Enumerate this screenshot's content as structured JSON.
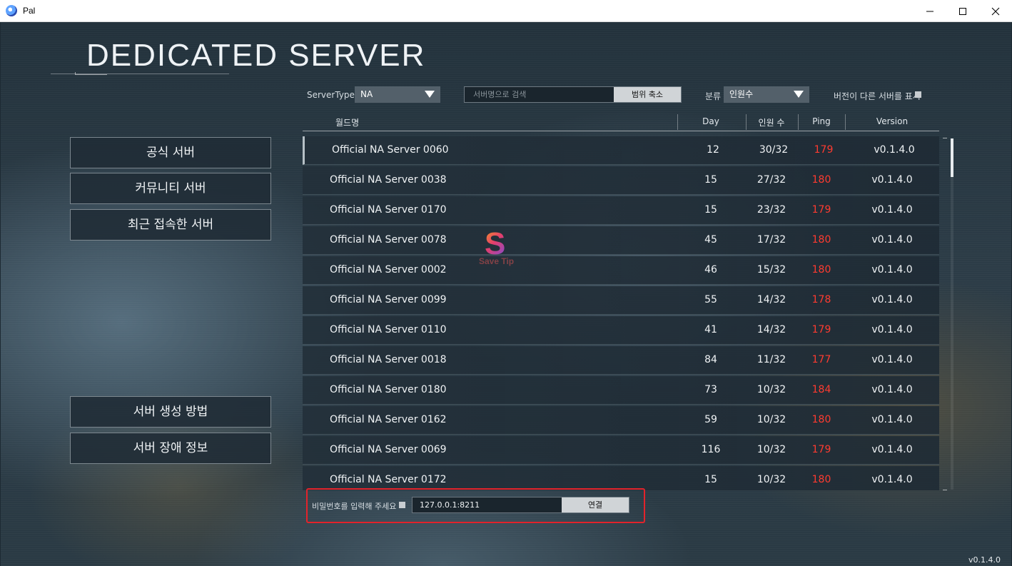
{
  "window": {
    "title": "Pal",
    "icon": "pal-app-icon",
    "controls": [
      "minimize-icon",
      "maximize-icon",
      "close-icon"
    ]
  },
  "header": {
    "title": "DEDICATED SERVER"
  },
  "filters": {
    "server_type_label": "ServerType",
    "server_type_value": "NA",
    "search_placeholder": "서버명으로 검색",
    "search_button": "범위 축소",
    "sort_label": "분류",
    "sort_value": "인원수",
    "show_other_versions_label": "버전이 다른 서버를 표시",
    "show_other_versions_checked": false
  },
  "table": {
    "columns": [
      "월드명",
      "Day",
      "인원 수",
      "Ping",
      "Version"
    ],
    "rows": [
      {
        "name": "Official NA Server 0060",
        "day": "12",
        "players": "30/32",
        "ping": "179",
        "version": "v0.1.4.0"
      },
      {
        "name": "Official NA Server 0038",
        "day": "15",
        "players": "27/32",
        "ping": "180",
        "version": "v0.1.4.0"
      },
      {
        "name": "Official NA Server 0170",
        "day": "15",
        "players": "23/32",
        "ping": "179",
        "version": "v0.1.4.0"
      },
      {
        "name": "Official NA Server 0078",
        "day": "45",
        "players": "17/32",
        "ping": "180",
        "version": "v0.1.4.0"
      },
      {
        "name": "Official NA Server 0002",
        "day": "46",
        "players": "15/32",
        "ping": "180",
        "version": "v0.1.4.0"
      },
      {
        "name": "Official NA Server 0099",
        "day": "55",
        "players": "14/32",
        "ping": "178",
        "version": "v0.1.4.0"
      },
      {
        "name": "Official NA Server 0110",
        "day": "41",
        "players": "14/32",
        "ping": "179",
        "version": "v0.1.4.0"
      },
      {
        "name": "Official NA Server 0018",
        "day": "84",
        "players": "11/32",
        "ping": "177",
        "version": "v0.1.4.0"
      },
      {
        "name": "Official NA Server 0180",
        "day": "73",
        "players": "10/32",
        "ping": "184",
        "version": "v0.1.4.0"
      },
      {
        "name": "Official NA Server 0162",
        "day": "59",
        "players": "10/32",
        "ping": "180",
        "version": "v0.1.4.0"
      },
      {
        "name": "Official NA Server 0069",
        "day": "116",
        "players": "10/32",
        "ping": "179",
        "version": "v0.1.4.0"
      },
      {
        "name": "Official NA Server 0172",
        "day": "15",
        "players": "10/32",
        "ping": "180",
        "version": "v0.1.4.0"
      }
    ],
    "ping_color": "#ff3b30"
  },
  "sidebar": {
    "top_items": [
      {
        "label": "공식 서버"
      },
      {
        "label": "커뮤니티 서버"
      },
      {
        "label": "최근 접속한 서버"
      }
    ],
    "bottom_items": [
      {
        "label": "서버 생성 방법"
      },
      {
        "label": "서버 장애 정보"
      }
    ]
  },
  "direct_connect": {
    "password_label": "비밀번호를 입력해 주세요",
    "password_checked": false,
    "address_value": "127.0.0.1:8211",
    "connect_button": "연결",
    "highlight_color": "#e3232b"
  },
  "footer": {
    "version": "v0.1.4.0"
  },
  "watermark": {
    "letter": "S",
    "text": "Save Tip"
  }
}
